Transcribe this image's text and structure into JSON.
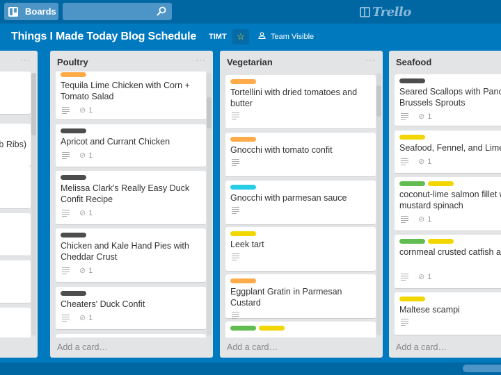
{
  "topbar": {
    "boards_label": "Boards",
    "search_placeholder": "",
    "logo_text": "Trello"
  },
  "board": {
    "title": "Things I Made Today Blog Schedule",
    "team_abbrev": "TIMT",
    "starred": true,
    "visibility": "Team Visible"
  },
  "colors": {
    "orange": "#ffab4a",
    "black": "#4d4d4d",
    "sky": "#29cce5",
    "yellow": "#f2d600",
    "green": "#61bd4f",
    "board_bg": "#0079bf",
    "header_bg": "#0067a3"
  },
  "lists": [
    {
      "name": "",
      "add_card_label": "",
      "cards": [
        {
          "title": "",
          "labels": []
        },
        {
          "title": "b Ribs)",
          "labels": []
        },
        {
          "title": "",
          "labels": []
        },
        {
          "title": "",
          "labels": []
        },
        {
          "title": "",
          "labels": []
        },
        {
          "title": "",
          "labels": []
        }
      ]
    },
    {
      "name": "Poultry",
      "add_card_label": "Add a card…",
      "cards": [
        {
          "title": "Tequila Lime Chicken with Corn + Tomato Salad",
          "labels": [
            "orange"
          ],
          "description": true,
          "attachments": "1"
        },
        {
          "title": "Apricot and Currant Chicken",
          "labels": [
            "black"
          ],
          "description": true,
          "attachments": "1"
        },
        {
          "title": "Melissa Clark's Really Easy Duck Confit Recipe",
          "labels": [
            "black"
          ],
          "description": true,
          "attachments": "1"
        },
        {
          "title": "Chicken and Kale Hand Pies with Cheddar Crust",
          "labels": [
            "black"
          ],
          "description": true,
          "attachments": "1"
        },
        {
          "title": "Cheaters' Duck Confit",
          "labels": [
            "black"
          ],
          "description": true,
          "attachments": "1"
        },
        {
          "title": "",
          "labels": []
        }
      ]
    },
    {
      "name": "Vegetarian",
      "add_card_label": "Add a card…",
      "cards": [
        {
          "title": "Tortellini with dried tomatoes and butter",
          "labels": [
            "orange"
          ],
          "description": true
        },
        {
          "title": "Gnocchi with tomato confit",
          "labels": [
            "orange"
          ],
          "description": true
        },
        {
          "title": "Gnocchi with parmesan sauce",
          "labels": [
            "sky"
          ],
          "description": true
        },
        {
          "title": "Leek tart",
          "labels": [
            "yellow"
          ],
          "description": true
        },
        {
          "title": "Eggplant Gratin in Parmesan Custard",
          "labels": [
            "orange"
          ],
          "description": true
        },
        {
          "title": "",
          "labels": [
            "green",
            "yellow"
          ]
        }
      ]
    },
    {
      "name": "Seafood",
      "add_card_label": "Add a card…",
      "cards": [
        {
          "title": "Seared Scallops with Pancetta Brussels Sprouts",
          "labels": [
            "black"
          ],
          "description": true,
          "attachments": "1"
        },
        {
          "title": "Seafood, Fennel, and Lime",
          "labels": [
            "yellow"
          ],
          "description": true,
          "attachments": "1"
        },
        {
          "title": "coconut-lime salmon fillet with mustard spinach",
          "labels": [
            "green",
            "yellow"
          ],
          "description": true,
          "attachments": "1"
        },
        {
          "title": "cornmeal crusted catfish and fennel",
          "labels": [
            "green",
            "yellow"
          ],
          "description": true,
          "attachments": "1"
        },
        {
          "title": "Maltese scampi",
          "labels": [
            "yellow"
          ],
          "description": true
        }
      ]
    }
  ],
  "list_menu_glyph": "···"
}
